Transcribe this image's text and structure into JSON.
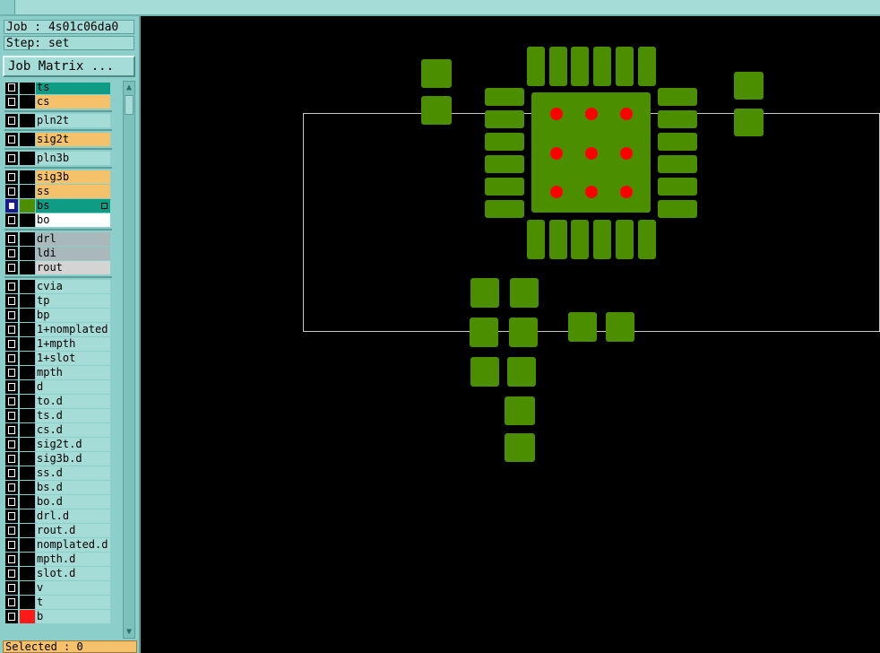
{
  "colors": {
    "panel": "#8ccfca",
    "cell": "#a6dcd8",
    "signal_orange": "#f6c16b",
    "active_teal": "#0f9c85",
    "gray_layer": "#a9b8bb",
    "pad_green": "#4b8e00",
    "via_red": "#ff0000"
  },
  "info": {
    "job": "Job : 4s01c06da0",
    "step": "Step: set"
  },
  "job_matrix_label": "Job Matrix ...",
  "layers": [
    {
      "name": "ts",
      "color": "#0f9c85"
    },
    {
      "name": "cs",
      "color": "#f6c16b"
    },
    {
      "name": "pln2t",
      "color": "#a6dcd8"
    },
    {
      "name": "sig2t",
      "color": "#f6c16b"
    },
    {
      "name": "pln3b",
      "color": "#a6dcd8"
    },
    {
      "name": "sig3b",
      "color": "#f6c16b"
    },
    {
      "name": "ss",
      "color": "#f6c16b"
    },
    {
      "name": "bs",
      "color": "#0f9c85",
      "active": true
    },
    {
      "name": "bo",
      "color": "#ffffff"
    },
    {
      "name": "drl",
      "color": "#a9b8bb"
    },
    {
      "name": "ldi",
      "color": "#a9b8bb"
    },
    {
      "name": "rout",
      "color": "#d4d4d4"
    },
    {
      "name": "cvia",
      "color": "#a6dcd8"
    },
    {
      "name": "tp",
      "color": "#a6dcd8"
    },
    {
      "name": "bp",
      "color": "#a6dcd8"
    },
    {
      "name": "1+nomplated",
      "color": "#a6dcd8"
    },
    {
      "name": "1+mpth",
      "color": "#a6dcd8"
    },
    {
      "name": "1+slot",
      "color": "#a6dcd8"
    },
    {
      "name": "mpth",
      "color": "#a6dcd8"
    },
    {
      "name": "d",
      "color": "#a6dcd8"
    },
    {
      "name": "to.d",
      "color": "#a6dcd8"
    },
    {
      "name": "ts.d",
      "color": "#a6dcd8"
    },
    {
      "name": "cs.d",
      "color": "#a6dcd8"
    },
    {
      "name": "sig2t.d",
      "color": "#a6dcd8"
    },
    {
      "name": "sig3b.d",
      "color": "#a6dcd8"
    },
    {
      "name": "ss.d",
      "color": "#a6dcd8"
    },
    {
      "name": "bs.d",
      "color": "#a6dcd8"
    },
    {
      "name": "bo.d",
      "color": "#a6dcd8"
    },
    {
      "name": "drl.d",
      "color": "#a6dcd8"
    },
    {
      "name": "rout.d",
      "color": "#a6dcd8"
    },
    {
      "name": "nomplated.d",
      "color": "#a6dcd8"
    },
    {
      "name": "mpth.d",
      "color": "#a6dcd8"
    },
    {
      "name": "slot.d",
      "color": "#a6dcd8"
    },
    {
      "name": "v",
      "color": "#a6dcd8"
    },
    {
      "name": "t",
      "color": "#a6dcd8"
    },
    {
      "name": "b",
      "color": "#a6dcd8",
      "swatch": "#ff1a1a"
    }
  ],
  "status": "Selected : 0",
  "icons": {
    "scroll_up": "scroll-up-arrow-icon",
    "scroll_down": "scroll-down-arrow-icon",
    "checkbox": "layer-checkbox-icon"
  }
}
